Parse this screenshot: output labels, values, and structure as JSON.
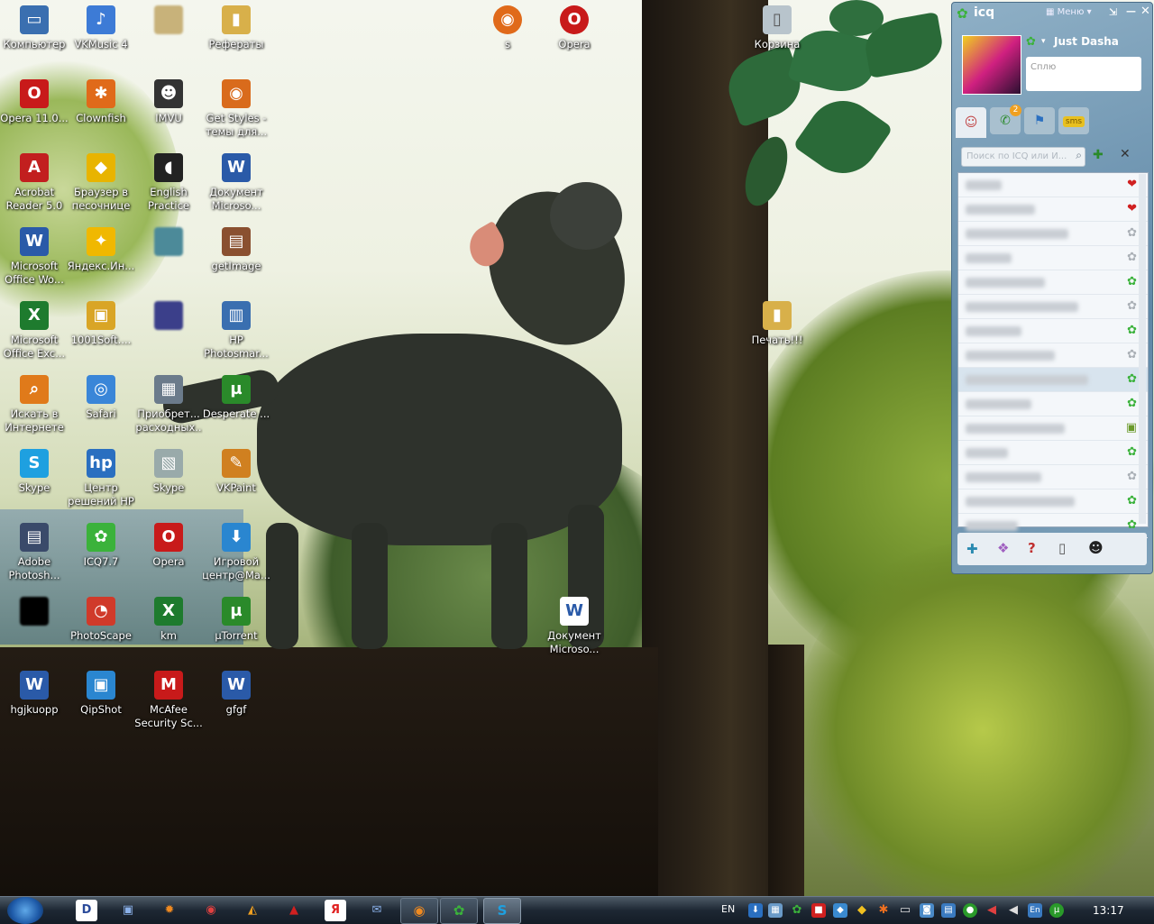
{
  "desktop": {
    "icons": [
      {
        "label": "Компьютер",
        "glyph": "▭",
        "color": "#3a6fb0"
      },
      {
        "label": "VKMusic 4",
        "glyph": "♪",
        "color": "#3d7bd6"
      },
      {
        "label": "",
        "glyph": "",
        "color": "#c8b27a"
      },
      {
        "label": "Рефераты",
        "glyph": "▮",
        "color": "#d8b04a"
      },
      {
        "label": "Opera 11.0...",
        "glyph": "O",
        "color": "#c81a1a"
      },
      {
        "label": "Clownfish",
        "glyph": "✱",
        "color": "#e06a1a"
      },
      {
        "label": "IMVU",
        "glyph": "☻",
        "color": "#333"
      },
      {
        "label": "Get Styles - темы для...",
        "glyph": "◉",
        "color": "#d96b1c"
      },
      {
        "label": "Acrobat Reader 5.0",
        "glyph": "A",
        "color": "#c21f1f"
      },
      {
        "label": "Браузер в песочнице",
        "glyph": "◆",
        "color": "#e8b400"
      },
      {
        "label": "English Practice",
        "glyph": "◖",
        "color": "#222"
      },
      {
        "label": "Документ Microso...",
        "glyph": "W",
        "color": "#2a5aa8"
      },
      {
        "label": "Microsoft Office Wo...",
        "glyph": "W",
        "color": "#2a5aa8"
      },
      {
        "label": "Яндекс.Ин...",
        "glyph": "✦",
        "color": "#f0b800"
      },
      {
        "label": "",
        "glyph": "",
        "color": "#4c8a99"
      },
      {
        "label": "getImage",
        "glyph": "▤",
        "color": "#8a5030"
      },
      {
        "label": "Microsoft Office Exc...",
        "glyph": "X",
        "color": "#1e7b2e"
      },
      {
        "label": "1001Soft....",
        "glyph": "▣",
        "color": "#d9a526"
      },
      {
        "label": "",
        "glyph": "",
        "color": "#3b3f8a"
      },
      {
        "label": "HP Photosmar...",
        "glyph": "▥",
        "color": "#3a6fb0"
      },
      {
        "label": "Искать в Интернете",
        "glyph": "⌕",
        "color": "#e07a1a"
      },
      {
        "label": "Safari",
        "glyph": "◎",
        "color": "#3a86d8"
      },
      {
        "label": "Приобрет... расходных...",
        "glyph": "▦",
        "color": "#6b7b8b"
      },
      {
        "label": "Desperate ...",
        "glyph": "µ",
        "color": "#2a8a2a"
      },
      {
        "label": "Skype",
        "glyph": "S",
        "color": "#1ea0e0"
      },
      {
        "label": "Центр решений HP",
        "glyph": "hp",
        "color": "#2a6fc0"
      },
      {
        "label": "Skype",
        "glyph": "▧",
        "color": "#9aa"
      },
      {
        "label": "VKPaint",
        "glyph": "✎",
        "color": "#d08020"
      },
      {
        "label": "Adobe Photosh...",
        "glyph": "▤",
        "color": "#3a4a6a"
      },
      {
        "label": "ICQ7.7",
        "glyph": "✿",
        "color": "#3bb23b"
      },
      {
        "label": "Opera",
        "glyph": "O",
        "color": "#c81a1a"
      },
      {
        "label": "Игровой центр@Ма...",
        "glyph": "⬇",
        "color": "#2a86d0"
      },
      {
        "label": "",
        "glyph": "",
        "color": "#000"
      },
      {
        "label": "PhotoScape",
        "glyph": "◔",
        "color": "#d03a2a"
      },
      {
        "label": "km",
        "glyph": "X",
        "color": "#1e7b2e"
      },
      {
        "label": "µTorrent",
        "glyph": "µ",
        "color": "#2a8a2a"
      },
      {
        "label": "hgjkuopp",
        "glyph": "W",
        "color": "#2a5aa8"
      },
      {
        "label": "QipShot",
        "glyph": "▣",
        "color": "#2a86d0"
      },
      {
        "label": "McAfee Security Sc...",
        "glyph": "M",
        "color": "#c81a1a"
      },
      {
        "label": "gfgf",
        "glyph": "W",
        "color": "#2a5aa8"
      }
    ],
    "top_icons": [
      {
        "label": "s",
        "glyph": "◉",
        "color": "#e06a1a"
      },
      {
        "label": "Opera",
        "glyph": "O",
        "color": "#c81a1a"
      },
      {
        "label": "Корзина",
        "glyph": "▯",
        "color": "#9ab"
      }
    ],
    "other_icons": [
      {
        "label": "Печать!!!",
        "glyph": "▮",
        "color": "#d8b04a"
      },
      {
        "label": "Документ Microso...",
        "glyph": "W",
        "color": "#2a5aa8"
      }
    ]
  },
  "icq": {
    "app_name": "icq",
    "menu_label": "Меню",
    "user_name": "Just Dasha",
    "status_text": "Сплю",
    "badge_count": "2",
    "sms_label": "sms",
    "search_placeholder": "Поиск по ICQ или И...",
    "contact_statuses": [
      "heart",
      "heart",
      "offline",
      "offline",
      "online",
      "offline",
      "online",
      "offline",
      "online-eye",
      "online",
      "tv",
      "online",
      "offline",
      "online",
      "online"
    ]
  },
  "taskbar": {
    "language": "EN",
    "tray_lang": "En",
    "clock": "13:17"
  }
}
